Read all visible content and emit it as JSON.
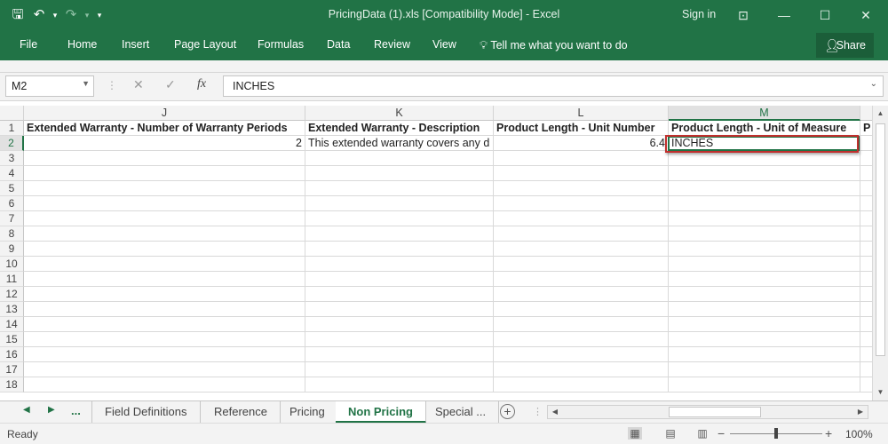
{
  "window": {
    "title": "PricingData (1).xls  [Compatibility Mode] - Excel",
    "sign_in": "Sign in",
    "qat": {
      "save": "🖫",
      "undo": "↶",
      "undo_dd": "▾",
      "redo": "↷",
      "redo_dd": "▾",
      "customize": "▾"
    },
    "controls": {
      "ribbon_options": "⊡",
      "minimize": "—",
      "restore": "☐",
      "close": "✕"
    }
  },
  "ribbon": {
    "tabs": [
      "File",
      "Home",
      "Insert",
      "Page Layout",
      "Formulas",
      "Data",
      "Review",
      "View"
    ],
    "tell_me": "Tell me what you want to do",
    "share": "Share"
  },
  "formula_bar": {
    "name_box": "M2",
    "cancel": "✕",
    "enter": "✓",
    "fx": "fx",
    "content": "INCHES"
  },
  "sheet": {
    "columns": [
      "J",
      "K",
      "L",
      "M"
    ],
    "selected_column": "M",
    "selected_row": 2,
    "row_numbers": [
      "1",
      "2",
      "3",
      "4",
      "5",
      "6",
      "7",
      "8",
      "9",
      "10",
      "11",
      "12",
      "13",
      "14",
      "15",
      "16",
      "17",
      "18"
    ],
    "headers": {
      "J": "Extended Warranty - Number of Warranty Periods",
      "K": "Extended Warranty - Description",
      "L": "Product Length - Unit Number",
      "M": "Product Length - Unit of Measure",
      "N": "P"
    },
    "row2": {
      "J": "2",
      "K": "This extended warranty covers any d",
      "L": "6.4",
      "M": "INCHES"
    }
  },
  "sheet_tabs": {
    "nav_prev": "◀",
    "nav_next": "▶",
    "more": "...",
    "tabs": [
      "Field Definitions",
      "Reference",
      "Pricing",
      "Non Pricing",
      "Special ..."
    ],
    "active": "Non Pricing",
    "add": "+"
  },
  "status_bar": {
    "status": "Ready",
    "zoom": "100%",
    "zoom_minus": "−",
    "zoom_plus": "+"
  }
}
